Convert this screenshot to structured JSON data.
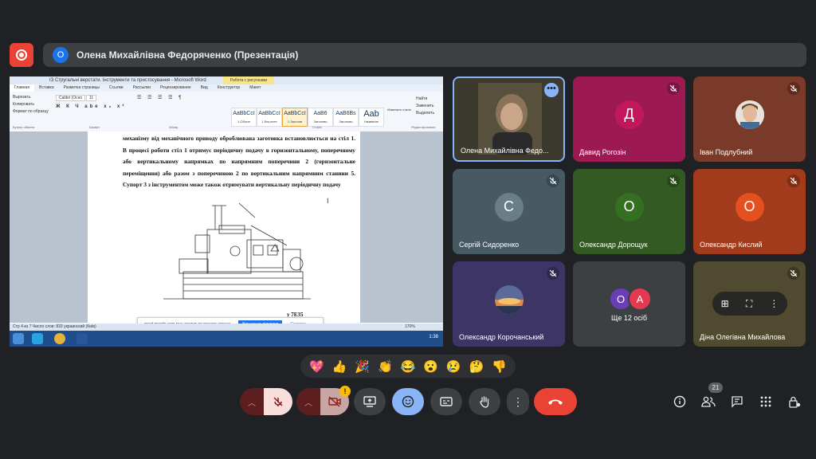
{
  "presentation": {
    "avatar_letter": "О",
    "title": "Олена Михайлівна Федоряченко (Презентація)"
  },
  "shared_screen": {
    "window_title": "ІЗ Стругальні верстати. Інструменти та пристосування - Microsoft Word",
    "context_tab": "Работа с рисунками",
    "ribbon_tabs": [
      "Главная",
      "Вставка",
      "Разметка страницы",
      "Ссылки",
      "Рассылки",
      "Рецензирование",
      "Вид",
      "Конструктор",
      "Макет"
    ],
    "clipboard": [
      "Вырезать",
      "Копировать",
      "Формат по образцу"
    ],
    "font_name": "Calibri (Осно",
    "font_size": "11",
    "styles": [
      {
        "sample": "AaBbCcI",
        "name": "1 Обычн"
      },
      {
        "sample": "AaBbCcI",
        "name": "1 Без инте"
      },
      {
        "sample": "AaBbCcI",
        "name": "1 Заголов"
      },
      {
        "sample": "AaB6",
        "name": "Заголово"
      },
      {
        "sample": "AaB6Bs",
        "name": "Заголово"
      },
      {
        "sample": "Aab",
        "name": "Название"
      }
    ],
    "change_styles": "Изменить стили",
    "editing": [
      "Найти",
      "Заменить",
      "Выделить"
    ],
    "group_labels": [
      "Буфер обмена",
      "Шрифт",
      "Абзац",
      "Стили",
      "Редактирование"
    ],
    "document_text": "механізму від механічного приводу оброблювана заготовка встановлюється на стіл 1. В процесі роботи стіл 1 отримує періодичну подачу в горизонтальному, поперечному або вертикальному напрямках по напрямним поперечини 2 (горизонтальне переміщення) або разом з поперечиною 2 по вертикальним напрямним станини 5. Супорт 3 з інструментом може також отримувати вертикальну періодичну подачу",
    "figure_caption": "у 7Е35",
    "banner_text": "meet.google.com має доступ до вашого екрана",
    "banner_button": "Більше не ділитися",
    "banner_hide": "Сховати",
    "status_left": "Стр 4 из 7   Число слов: 833   украинский (Київ)",
    "zoom": "170%",
    "clock": "1:38"
  },
  "tiles": [
    {
      "name": "Олена Михайлівна Федо...",
      "type": "video",
      "bg": "#3c3a2e"
    },
    {
      "name": "Давид Рогозін",
      "letter": "Д",
      "bg": "#9c1a51",
      "avatar_bg": "#c2185b"
    },
    {
      "name": "Іван Подлубний",
      "type": "photo",
      "bg": "#7a3a2a"
    },
    {
      "name": "Сергій Сидоренко",
      "letter": "С",
      "bg": "#475a64",
      "avatar_bg": "#6a7e88"
    },
    {
      "name": "Олександр Дорощук",
      "letter": "О",
      "bg": "#345a24",
      "avatar_bg": "#346f22"
    },
    {
      "name": "Олександр Кислий",
      "letter": "О",
      "bg": "#a23a1c",
      "avatar_bg": "#e4501e"
    },
    {
      "name": "Олександр Корочанський",
      "type": "photo",
      "bg": "#3d3566"
    },
    {
      "name": "Ще 12 осіб",
      "letters": [
        "О",
        "А"
      ],
      "bg": "#3c4043"
    },
    {
      "name": "Діна Олегівна Михайлова",
      "type": "photo",
      "bg": "#4f4a30"
    }
  ],
  "reactions": [
    "💖",
    "👍",
    "🎉",
    "👏",
    "😂",
    "😮",
    "😢",
    "🤔",
    "👎"
  ],
  "controls": {
    "participants_count": "21",
    "warning_badge": "!"
  }
}
